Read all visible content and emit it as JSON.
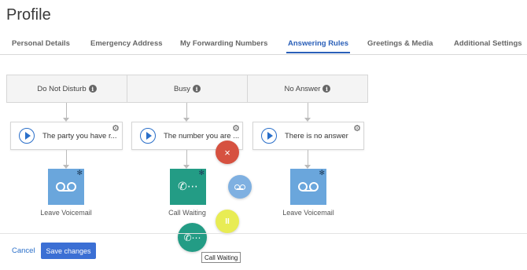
{
  "page": {
    "title": "Profile"
  },
  "tabs": [
    {
      "label": "Personal Details"
    },
    {
      "label": "Emergency Address"
    },
    {
      "label": "My Forwarding Numbers"
    },
    {
      "label": "Answering Rules",
      "active": true
    },
    {
      "label": "Greetings & Media"
    },
    {
      "label": "Additional Settings"
    }
  ],
  "rules": [
    {
      "header": "Do Not Disturb",
      "greeting": "The party you have r...",
      "action": "Leave Voicemail",
      "action_icon": "voicemail-icon",
      "tile_color": "#6aa6dc"
    },
    {
      "header": "Busy",
      "greeting": "The number you are ...",
      "action": "Call Waiting",
      "action_icon": "phone-dots-icon",
      "tile_color": "#239c85"
    },
    {
      "header": "No Answer",
      "greeting": "There is no answer",
      "action": "Leave Voicemail",
      "action_icon": "voicemail-icon",
      "tile_color": "#6aa6dc"
    }
  ],
  "action_menu": {
    "close_glyph": "×",
    "pause_glyph": "II",
    "colors": {
      "close": "#d65140",
      "voicemail": "#7fb0e1",
      "pause": "#e8ec54",
      "call": "#239c85"
    }
  },
  "tooltip": {
    "text": "Call Waiting"
  },
  "footer": {
    "cancel_label": "Cancel",
    "save_label": "Save changes"
  },
  "colors": {
    "accent": "#2a5fb8",
    "button": "#3b6fd4"
  }
}
